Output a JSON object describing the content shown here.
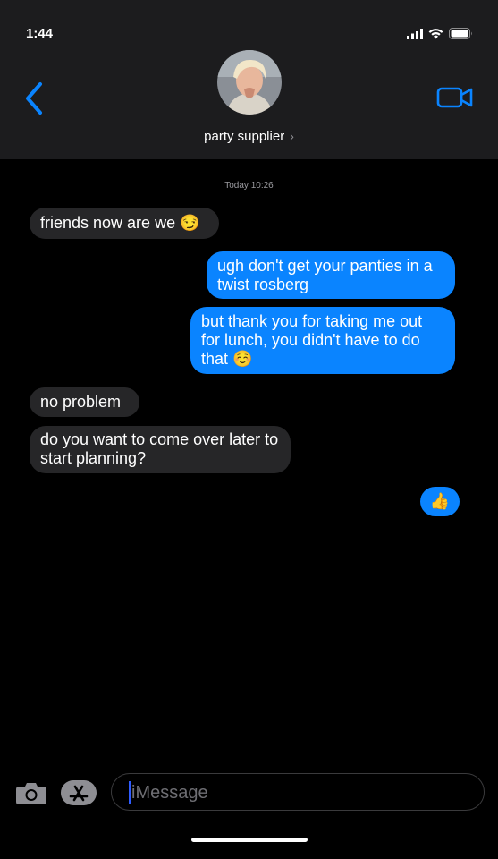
{
  "status_bar": {
    "time": "1:44"
  },
  "header": {
    "contact_name": "party supplier",
    "chevron": "›"
  },
  "conversation": {
    "timestamp": "Today 10:26",
    "messages": [
      {
        "direction": "incoming",
        "text": "friends now are we 😏"
      },
      {
        "direction": "outgoing",
        "text": "ugh don't get your panties in a twist rosberg"
      },
      {
        "direction": "outgoing",
        "text": "but thank you for taking me out for lunch, you didn't have to do that ☺️"
      },
      {
        "direction": "incoming",
        "text": "no problem"
      },
      {
        "direction": "incoming",
        "text": "do you want to come over later to start planning?"
      },
      {
        "direction": "outgoing",
        "text": "👍"
      }
    ]
  },
  "input_bar": {
    "placeholder": "iMessage"
  },
  "colors": {
    "header_bg": "#1c1c1e",
    "incoming_bubble": "#262628",
    "outgoing_bubble": "#0a84ff",
    "accent": "#0a84ff"
  },
  "icons": [
    "signal-icon",
    "wifi-icon",
    "battery-icon",
    "back-chevron-icon",
    "video-camera-icon",
    "camera-icon",
    "app-store-icon"
  ]
}
